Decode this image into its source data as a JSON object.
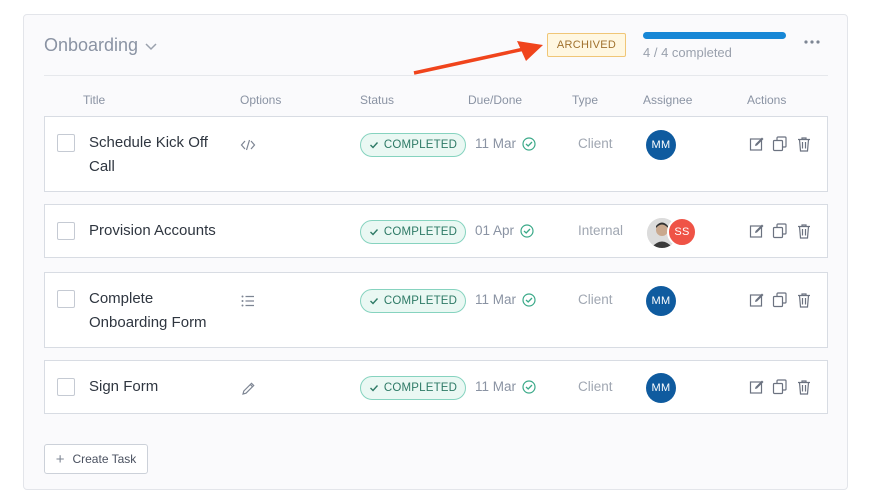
{
  "section": {
    "title": "Onboarding",
    "badge": "ARCHIVED"
  },
  "progress": {
    "text": "4 / 4 completed",
    "fraction": 1.0,
    "color": "#1787d6"
  },
  "columns": [
    "Title",
    "Options",
    "Status",
    "Due/Done",
    "Type",
    "Assignee",
    "Actions"
  ],
  "tasks": [
    {
      "title": "Schedule Kick Off Call",
      "option_icon": "code-icon",
      "status": "COMPLETED",
      "due": "11 Mar",
      "type": "Client",
      "assignee": "MM"
    },
    {
      "title": "Provision Accounts",
      "option_icon": "",
      "status": "COMPLETED",
      "due": "01 Apr",
      "type": "Internal",
      "assignee": "SS"
    },
    {
      "title": "Complete Onboarding Form",
      "option_icon": "checklist-icon",
      "status": "COMPLETED",
      "due": "11 Mar",
      "type": "Client",
      "assignee": "MM"
    },
    {
      "title": "Sign Form",
      "option_icon": "pen-icon",
      "status": "COMPLETED",
      "due": "11 Mar",
      "type": "Client",
      "assignee": "MM"
    }
  ],
  "create_button": "Create Task",
  "colors": {
    "accent": "#1787d6",
    "status_green": "#2e7a66",
    "archived": "#a0712d",
    "arrow": "#f0441c",
    "avatar_mm": "#0f5b9f",
    "avatar_ss": "#ef5346"
  }
}
